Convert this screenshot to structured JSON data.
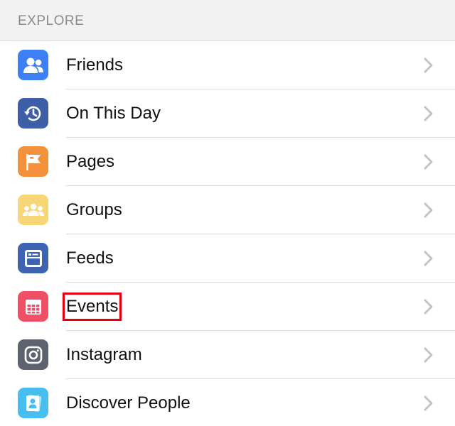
{
  "section": {
    "title": "EXPLORE"
  },
  "colors": {
    "friends": "#3f7ff4",
    "on_this_day": "#3e5ea8",
    "pages": "#f3913d",
    "groups": "#f7d677",
    "feeds": "#3e63b0",
    "events": "#ef5066",
    "instagram": "#5e6370",
    "discover_people": "#48bdf0",
    "highlight": "#e3000f",
    "chevron": "#c4c4c8"
  },
  "items": [
    {
      "label": "Friends",
      "icon": "friends-icon"
    },
    {
      "label": "On This Day",
      "icon": "on-this-day-icon"
    },
    {
      "label": "Pages",
      "icon": "pages-flag-icon"
    },
    {
      "label": "Groups",
      "icon": "groups-icon"
    },
    {
      "label": "Feeds",
      "icon": "feeds-icon"
    },
    {
      "label": "Events",
      "icon": "events-calendar-icon"
    },
    {
      "label": "Instagram",
      "icon": "instagram-icon"
    },
    {
      "label": "Discover People",
      "icon": "discover-people-icon"
    }
  ]
}
